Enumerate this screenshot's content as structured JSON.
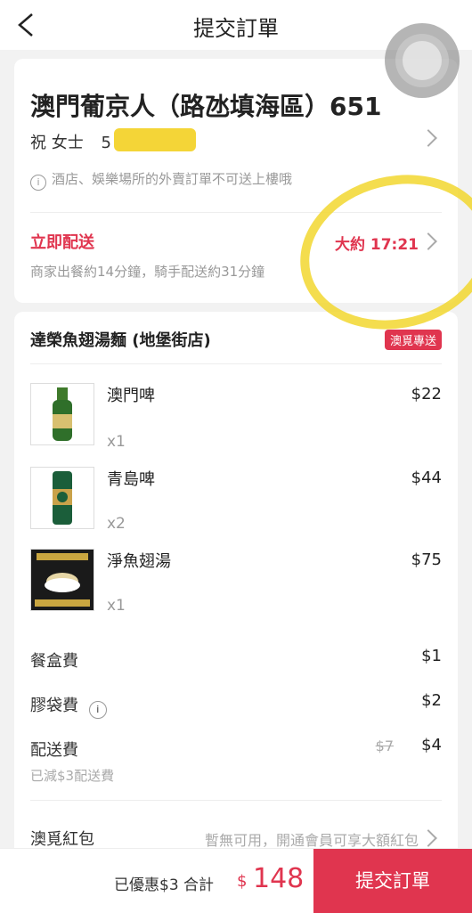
{
  "header": {
    "title": "提交訂單"
  },
  "address": {
    "title": "澳門葡京人（路氹填海區）651",
    "recipient": "祝 女士",
    "phone_visible": "5",
    "notice": "酒店、娛樂場所的外賣訂單不可送上樓哦"
  },
  "delivery": {
    "label": "立即配送",
    "time": "大約 17:21",
    "sub": "商家出餐約14分鐘，騎手配送約31分鐘"
  },
  "store": {
    "name": "達榮魚翅湯麵 (地堡街店)",
    "badge": "澳覓專送"
  },
  "items": [
    {
      "name": "澳門啤",
      "qty": "x1",
      "price": "$22"
    },
    {
      "name": "青島啤",
      "qty": "x2",
      "price": "$44"
    },
    {
      "name": "淨魚翅湯",
      "qty": "x1",
      "price": "$75"
    }
  ],
  "fees": [
    {
      "label": "餐盒費",
      "value": "$1"
    },
    {
      "label": "膠袋費",
      "value": "$2"
    },
    {
      "label": "配送費",
      "original": "$7",
      "value": "$4",
      "note": "已減$3配送費"
    }
  ],
  "coupon": {
    "label": "澳覓紅包",
    "value": "暫無可用，開通會員可享大額紅包"
  },
  "footer": {
    "savings": "已優惠$3 合計",
    "currency": "$",
    "total": "148",
    "submit": "提交訂單"
  },
  "colors": {
    "accent": "#e0354f",
    "highlight": "#f2d72f"
  }
}
